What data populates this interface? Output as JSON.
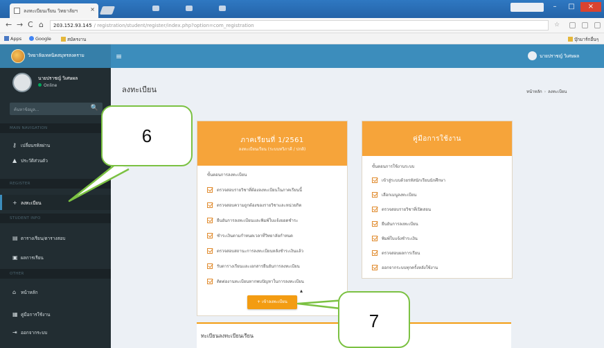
{
  "browser": {
    "tab_title": "ลงทะเบียนเรียน วิทยาลัยฯ",
    "tab_close": "×",
    "url_host": "203.152.93.145",
    "url_path": "/ registration/student/register/index.php?option=com_registration",
    "bookmarks": [
      {
        "label": "Apps",
        "icon": "apps-icon"
      },
      {
        "label": "Google",
        "icon": "google-icon"
      },
      {
        "label": "สมัครงาน",
        "icon": "folder-icon"
      }
    ],
    "other_bookmarks": "บุ๊กมาร์กอื่นๆ",
    "window_controls": [
      "–",
      "□",
      "×"
    ],
    "nav_icons": {
      "back": "←",
      "forward": "→",
      "reload": "C",
      "home": "⌂"
    },
    "star": "☆"
  },
  "header": {
    "logo_text": "วิทยาลัยเทคนิคสมุทรสงคราม",
    "menu_toggle": "≡",
    "user_menu_label": "นายปราชญ์ วิเศษผล"
  },
  "sidebar": {
    "user_name": "นายปราชญ์ วิเศษผล",
    "user_status": "Online",
    "search_placeholder": "ค้นหาข้อมูล...",
    "search_icon": "🔍",
    "sections": [
      {
        "header": "MAIN NAVIGATION",
        "items": [
          {
            "label": "เปลี่ยนรหัสผ่าน",
            "icon": "key-icon",
            "glyph": "⚷",
            "active": false
          },
          {
            "label": "ประวัติส่วนตัว",
            "icon": "user-icon",
            "glyph": "▲",
            "active": false
          }
        ]
      },
      {
        "header": "REGISTER",
        "items": [
          {
            "label": "ลงทะเบียน",
            "icon": "plus-icon",
            "glyph": "+",
            "active": true
          }
        ]
      },
      {
        "header": "STUDENT INFO",
        "items": [
          {
            "label": "ตารางเรียน/ตารางสอบ",
            "icon": "table-icon",
            "glyph": "▤",
            "active": false
          },
          {
            "label": "ผลการเรียน",
            "icon": "report-icon",
            "glyph": "▣",
            "active": false
          }
        ]
      },
      {
        "header": "OTHER",
        "items": [
          {
            "label": "หน้าหลัก",
            "icon": "home-icon",
            "glyph": "⌂",
            "active": false
          },
          {
            "label": "คู่มือการใช้งาน",
            "icon": "book-icon",
            "glyph": "▦",
            "active": false
          },
          {
            "label": "ออกจากระบบ",
            "icon": "logout-icon",
            "glyph": "⇥",
            "active": false
          }
        ]
      }
    ]
  },
  "content": {
    "page_title": "ลงทะเบียน",
    "breadcrumb": [
      "หน้าหลัก",
      "ลงทะเบียน"
    ],
    "register_box": {
      "title": "ภาคเรียนที่ 1/2561",
      "subtitle": "ลงทะเบียนเรียน (ระบบทวิภาคี / ปกติ)",
      "section_label": "ขั้นตอนการลงทะเบียน",
      "checklist": [
        "ตรวจสอบรายวิชาที่ต้องลงทะเบียนในภาคเรียนนี้",
        "ตรวจสอบความถูกต้องของรายวิชาและหน่วยกิต",
        "ยืนยันการลงทะเบียนและพิมพ์ใบแจ้งยอดชำระ",
        "ชำระเงินตามกำหนดเวลาที่วิทยาลัยกำหนด",
        "ตรวจสอบสถานะการลงทะเบียนหลังชำระเงินแล้ว",
        "รับตารางเรียนและเอกสารยืนยันการลงทะเบียน",
        "ติดต่องานทะเบียนหากพบปัญหาในการลงทะเบียน"
      ],
      "button_label": "+ เข้าลงทะเบียน"
    },
    "manual_box": {
      "title": "คู่มือการใช้งาน",
      "section_label": "ขั้นตอนการใช้งานระบบ",
      "checklist": [
        "เข้าสู่ระบบด้วยรหัสนักเรียนนักศึกษา",
        "เลือกเมนูลงทะเบียน",
        "ตรวจสอบรายวิชาที่เปิดสอน",
        "ยืนยันการลงทะเบียน",
        "พิมพ์ใบแจ้งชำระเงิน",
        "ตรวจสอบผลการเรียน",
        "ออกจากระบบทุกครั้งหลังใช้งาน"
      ]
    },
    "bottom_box_title": "ทะเบียนลงทะเบียนเรียน"
  },
  "callouts": [
    {
      "label": "6",
      "target": "sidebar-item-register"
    },
    {
      "label": "7",
      "target": "register-button"
    }
  ],
  "colors": {
    "header_blue": "#3c8dbc",
    "sidebar_dark": "#222d32",
    "box_orange": "#f6a43a",
    "button_orange": "#f39c12",
    "callout_green": "#7bc142"
  }
}
